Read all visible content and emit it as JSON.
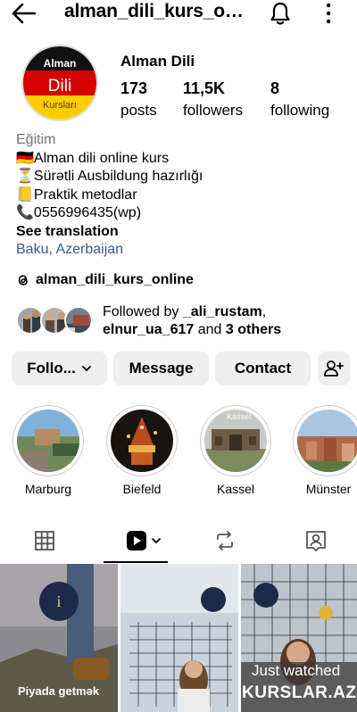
{
  "header": {
    "username": "alman_dili_kurs_online"
  },
  "profile": {
    "avatar_text": [
      "Alman",
      "Dili",
      "Kursları"
    ],
    "display_name": "Alman Dili",
    "stats": [
      {
        "value": "173",
        "label": "posts"
      },
      {
        "value": "11,5K",
        "label": "followers"
      },
      {
        "value": "8",
        "label": "following"
      }
    ]
  },
  "bio": {
    "category": "Eğitim",
    "lines": [
      "🇩🇪Alman dili online kurs",
      "⏳Sürətli Ausbildung hazırlığı",
      "📒Praktik metodlar",
      "📞0556996435(wp)"
    ],
    "see_translation": "See translation",
    "location": "Baku, Azerbaijan"
  },
  "threads": {
    "handle": "alman_dili_kurs_online"
  },
  "followed_by": {
    "prefix": "Followed by ",
    "user1": "_ali_rustam",
    "user2": "elnur_ua_617",
    "and": " and ",
    "others": "3 others"
  },
  "actions": {
    "follow": "Follo...",
    "message": "Message",
    "contact": "Contact"
  },
  "highlights": [
    {
      "name": "Marburg"
    },
    {
      "name": "Biefeld"
    },
    {
      "name": "Kassel",
      "overlay": "Kassel"
    },
    {
      "name": "Münster"
    }
  ],
  "grid": {
    "caption1": "Piyada getmək",
    "just_watched": "Just watched",
    "watermark": "KURSLAR.AZ"
  },
  "colors": {
    "link": "#385898",
    "secondary": "#737373",
    "button_bg": "#efefef"
  }
}
